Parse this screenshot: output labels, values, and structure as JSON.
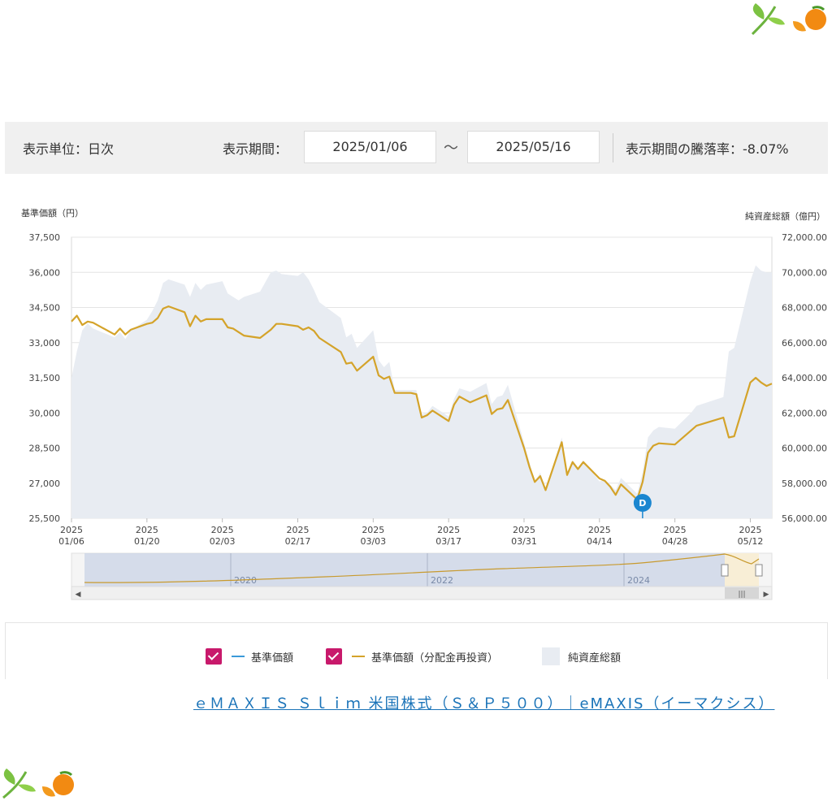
{
  "toolbar": {
    "unit_text": "表示単位：日次",
    "period_label": "表示期間：",
    "start_date": "2025/01/06",
    "tilde": "〜",
    "end_date": "2025/05/16",
    "change_text": "表示期間の騰落率：-8.07%"
  },
  "legend": {
    "item1": "基準価額",
    "item2": "基準価額（分配金再投資）",
    "item3": "純資産総額"
  },
  "footer_link": "ｅＭＡＸＩＳ Ｓｌｉｍ 米国株式（Ｓ＆Ｐ５００）｜eMAXIS（イーマクシス）",
  "colors": {
    "price_line": "#d4a32a",
    "nav_area": "#e8ecf2",
    "checkbox": "#c8196b",
    "marker": "#1a86d0",
    "base_line": "#3a9ad9"
  },
  "chart_data": {
    "type": "line",
    "ylabel_left": "基準価額（円）",
    "ylabel_right": "純資産総額（億円）",
    "ylim_left": [
      25500,
      37500
    ],
    "ylim_right": [
      56000,
      72000
    ],
    "yticks_left": [
      "37,500",
      "36,000",
      "34,500",
      "33,000",
      "31,500",
      "30,000",
      "28,500",
      "27,000",
      "25,500"
    ],
    "yticks_right": [
      "72,000.00",
      "70,000.00",
      "68,000.00",
      "66,000.00",
      "64,000.00",
      "62,000.00",
      "60,000.00",
      "58,000.00",
      "56,000.00"
    ],
    "x_tick_dates": [
      "2025/01/06",
      "2025/01/20",
      "2025/02/03",
      "2025/02/17",
      "2025/03/03",
      "2025/03/17",
      "2025/03/31",
      "2025/04/14",
      "2025/04/28",
      "2025/05/12"
    ],
    "x_tick_year": "2025",
    "x_tick_labels": [
      "01/06",
      "01/20",
      "02/03",
      "02/17",
      "03/03",
      "03/17",
      "03/31",
      "04/14",
      "04/28",
      "05/12"
    ],
    "x": [
      "2025/01/06",
      "2025/01/07",
      "2025/01/08",
      "2025/01/09",
      "2025/01/10",
      "2025/01/14",
      "2025/01/15",
      "2025/01/16",
      "2025/01/17",
      "2025/01/20",
      "2025/01/21",
      "2025/01/22",
      "2025/01/23",
      "2025/01/24",
      "2025/01/27",
      "2025/01/28",
      "2025/01/29",
      "2025/01/30",
      "2025/01/31",
      "2025/02/03",
      "2025/02/04",
      "2025/02/05",
      "2025/02/06",
      "2025/02/07",
      "2025/02/10",
      "2025/02/12",
      "2025/02/13",
      "2025/02/14",
      "2025/02/17",
      "2025/02/18",
      "2025/02/19",
      "2025/02/20",
      "2025/02/21",
      "2025/02/25",
      "2025/02/26",
      "2025/02/27",
      "2025/02/28",
      "2025/03/03",
      "2025/03/04",
      "2025/03/05",
      "2025/03/06",
      "2025/03/07",
      "2025/03/10",
      "2025/03/11",
      "2025/03/12",
      "2025/03/13",
      "2025/03/14",
      "2025/03/17",
      "2025/03/18",
      "2025/03/19",
      "2025/03/21",
      "2025/03/24",
      "2025/03/25",
      "2025/03/26",
      "2025/03/27",
      "2025/03/28",
      "2025/03/31",
      "2025/04/01",
      "2025/04/02",
      "2025/04/03",
      "2025/04/04",
      "2025/04/07",
      "2025/04/08",
      "2025/04/09",
      "2025/04/10",
      "2025/04/11",
      "2025/04/14",
      "2025/04/15",
      "2025/04/16",
      "2025/04/17",
      "2025/04/18",
      "2025/04/21",
      "2025/04/22",
      "2025/04/23",
      "2025/04/24",
      "2025/04/25",
      "2025/04/28",
      "2025/05/01",
      "2025/05/02",
      "2025/05/07",
      "2025/05/08",
      "2025/05/09",
      "2025/05/12",
      "2025/05/13",
      "2025/05/14",
      "2025/05/15",
      "2025/05/16"
    ],
    "series": [
      {
        "name": "基準価額（分配金再投資）",
        "axis": "left",
        "values": [
          33900,
          34150,
          33750,
          33900,
          33850,
          33350,
          33600,
          33350,
          33550,
          33800,
          33850,
          34050,
          34450,
          34550,
          34300,
          33700,
          34150,
          33900,
          34000,
          34000,
          33650,
          33600,
          33450,
          33300,
          33200,
          33550,
          33800,
          33800,
          33700,
          33550,
          33650,
          33500,
          33200,
          32600,
          32100,
          32150,
          31800,
          32400,
          31600,
          31450,
          31550,
          30850,
          30850,
          30800,
          29800,
          29900,
          30100,
          29650,
          30350,
          30700,
          30450,
          30750,
          29950,
          30150,
          30200,
          30550,
          28500,
          27700,
          27050,
          27300,
          26700,
          28750,
          27350,
          27900,
          27600,
          27900,
          27200,
          27100,
          26850,
          26500,
          26950,
          26300,
          27050,
          28300,
          28600,
          28700,
          28650,
          29250,
          29450,
          29800,
          28950,
          29000,
          31300,
          31500,
          31300,
          31150,
          31250
        ]
      },
      {
        "name": "純資産総額",
        "axis": "right",
        "values": [
          64000,
          65500,
          66700,
          67100,
          66800,
          66300,
          66600,
          66200,
          66700,
          67300,
          67800,
          68400,
          69400,
          69600,
          69300,
          68600,
          69400,
          69000,
          69300,
          69500,
          68800,
          68600,
          68400,
          68600,
          68900,
          70000,
          70100,
          69900,
          69800,
          70000,
          69600,
          69000,
          68300,
          67400,
          66300,
          66500,
          65700,
          66700,
          65000,
          64600,
          64900,
          63300,
          63300,
          63300,
          61900,
          62000,
          62400,
          61800,
          62800,
          63400,
          63200,
          63700,
          62500,
          62900,
          63000,
          63600,
          60300,
          59200,
          58100,
          58600,
          57600,
          60600,
          58600,
          59300,
          58900,
          59300,
          58100,
          58200,
          57900,
          57600,
          58300,
          57400,
          58600,
          60600,
          61000,
          61200,
          61100,
          62000,
          62400,
          62900,
          65500,
          65700,
          69500,
          70400,
          70100,
          70000,
          70000
        ]
      }
    ],
    "marker": {
      "date": "2025/04/22",
      "label": "D"
    },
    "navigator": {
      "year_labels": [
        "2020",
        "2022",
        "2024"
      ]
    },
    "grid": true,
    "legend_position": "bottom"
  }
}
